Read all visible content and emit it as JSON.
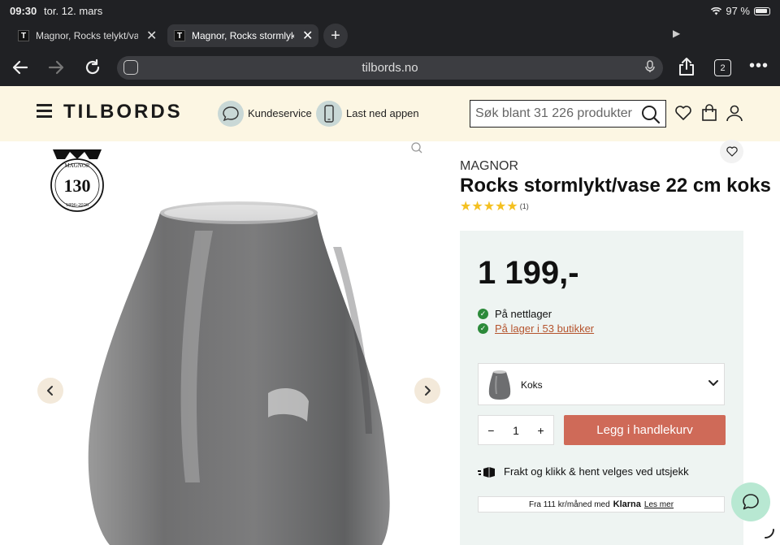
{
  "status_bar": {
    "time": "09:30",
    "date": "tor. 12. mars",
    "battery": "97 %"
  },
  "tabs": [
    {
      "favicon": "T",
      "title": "Magnor, Rocks telykt/vase",
      "active": false
    },
    {
      "favicon": "T",
      "title": "Magnor, Rocks stormlykt",
      "active": true
    }
  ],
  "browser": {
    "url": "tilbords.no",
    "tab_count": "2"
  },
  "header": {
    "logo": "TILBORDS",
    "customer_service": "Kundeservice",
    "download_app": "Last ned appen",
    "search_placeholder": "Søk blant 31 226 produkter"
  },
  "badge": {
    "brand": "MAGNOR",
    "number": "130",
    "years": "1896-2026"
  },
  "product": {
    "brand": "MAGNOR",
    "title": "Rocks stormlykt/vase 22 cm koks",
    "rating": 5,
    "review_count": "(1)",
    "price": "1 199,-",
    "stock_online": "På nettlager",
    "stock_stores": "På lager i 53 butikker",
    "variant": "Koks",
    "quantity": "1",
    "qty_minus": "−",
    "qty_plus": "+",
    "add_to_cart": "Legg i handlekurv",
    "shipping": "Frakt og klikk & hent velges ved utsjekk",
    "klarna_prefix": "Fra 111 kr/måned med",
    "klarna_brand": "Klarna",
    "klarna_link": "Les mer"
  },
  "colors": {
    "header_bg": "#fcf6e3",
    "buybox_bg": "#eef4f2",
    "cta": "#cf6a58",
    "link": "#b5542e",
    "check": "#2c8a3a",
    "chat": "#b8e8d2"
  }
}
